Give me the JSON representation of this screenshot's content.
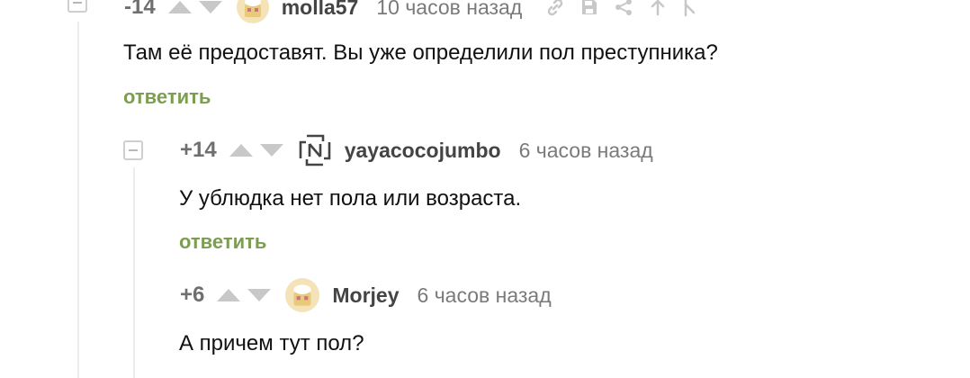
{
  "colors": {
    "accent_reply": "#7c9d52",
    "rating": "#6f6f6f",
    "muted": "#7a7a7a",
    "vote_arrow": "#c8c8c8"
  },
  "comments": [
    {
      "rating": "-14",
      "username": "molla57",
      "time": "10 часов назад",
      "avatar_icon": "default-avatar-icon",
      "tools": [
        "link-icon",
        "save-icon",
        "share-icon",
        "arrow-up-icon",
        "branch-icon"
      ],
      "text": "Там её предоставят. Вы уже определили пол преступника?",
      "reply_label": "ответить"
    },
    {
      "rating": "+14",
      "username": "yayacocojumbo",
      "time": "6 часов назад",
      "avatar_icon": "rammstein-logo-avatar-icon",
      "text": "У ублюдка нет пола или возраста.",
      "reply_label": "ответить"
    },
    {
      "rating": "+6",
      "username": "Morjey",
      "time": "6 часов назад",
      "avatar_icon": "default-avatar-icon",
      "text": "А причем тут пол?"
    }
  ]
}
